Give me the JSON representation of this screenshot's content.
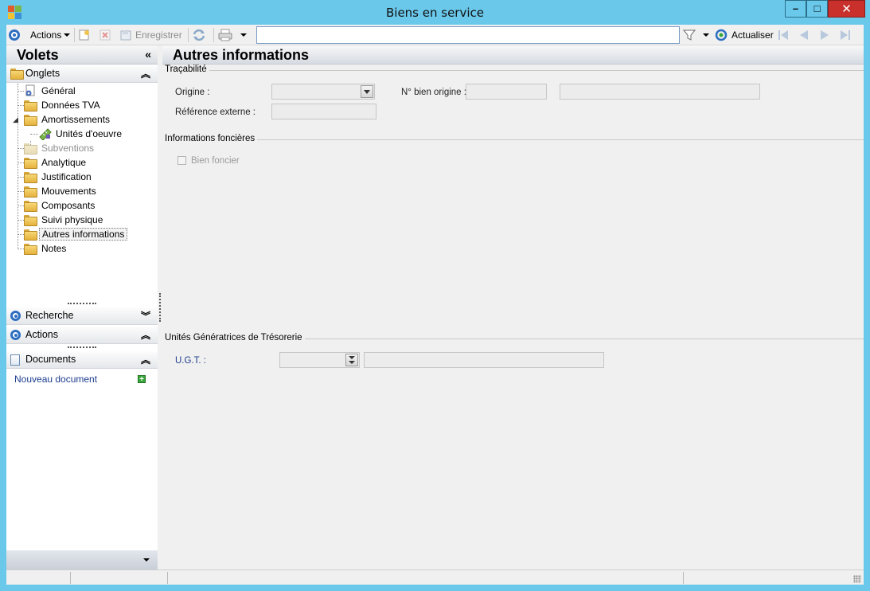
{
  "window": {
    "title": "Biens en service",
    "controls": {
      "minimize": "–",
      "maximize": "□",
      "close": "✕"
    }
  },
  "toolbar": {
    "actions_label": "Actions",
    "save_label": "Enregistrer",
    "search_value": "",
    "refresh_label": "Actualiser",
    "icons": [
      "target-icon",
      "new-doc-icon",
      "delete-icon",
      "save-icon",
      "sync-icon",
      "print-icon",
      "filter-icon",
      "refresh-icon",
      "first-icon",
      "prev-icon",
      "next-icon",
      "last-icon"
    ]
  },
  "sidebar": {
    "title": "Volets",
    "collapse_glyph": "«",
    "onglets": {
      "label": "Onglets",
      "items": [
        {
          "label": "Général"
        },
        {
          "label": "Données TVA"
        },
        {
          "label": "Amortissements"
        },
        {
          "label": "Unités d'oeuvre"
        },
        {
          "label": "Subventions"
        },
        {
          "label": "Analytique"
        },
        {
          "label": "Justification"
        },
        {
          "label": "Mouvements"
        },
        {
          "label": "Composants"
        },
        {
          "label": "Suivi physique"
        },
        {
          "label": "Autres informations"
        },
        {
          "label": "Notes"
        }
      ]
    },
    "recherche_label": "Recherche",
    "actions_label": "Actions",
    "documents": {
      "label": "Documents",
      "new_document": "Nouveau document"
    }
  },
  "main": {
    "title": "Autres informations",
    "tracabilite": {
      "title": "Traçabilité",
      "origine_label": "Origine :",
      "reference_label": "Référence externe :",
      "n_bien_origine_label": "N° bien origine :"
    },
    "foncieres": {
      "title": "Informations foncières",
      "bien_foncier_label": "Bien foncier"
    },
    "ugt": {
      "title": "Unités Génératrices de Trésorerie",
      "ugt_label": "U.G.T. :"
    }
  },
  "colors": {
    "window_frame": "#6ac8ea",
    "close_button": "#c9302c",
    "link_blue": "#1c3c8c",
    "accent_blue": "#2e6fc1"
  }
}
